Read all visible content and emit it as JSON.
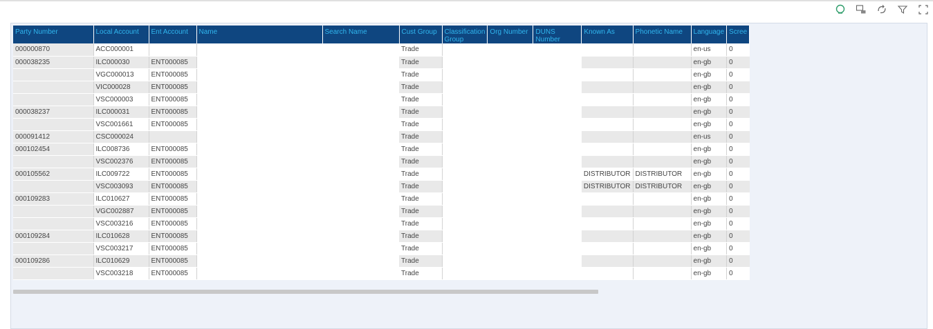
{
  "columns": [
    "Party Number",
    "Local Account",
    "Ent Account",
    "Name",
    "Search Name",
    "Cust Group",
    "Classification Group",
    "Org Number",
    "DUNS Number",
    "Known As",
    "Phonetic Name",
    "Language",
    "Scree"
  ],
  "rows": [
    {
      "party": "000000870",
      "local": "ACC000001",
      "ent": "",
      "cust": "Trade",
      "known": "",
      "phonetic": "",
      "lang": "en-us",
      "screen": "0"
    },
    {
      "party": "000038235",
      "local": "ILC000030",
      "ent": "ENT000085",
      "cust": "Trade",
      "known": "",
      "phonetic": "",
      "lang": "en-gb",
      "screen": "0"
    },
    {
      "party": "",
      "local": "VGC000013",
      "ent": "ENT000085",
      "cust": "Trade",
      "known": "",
      "phonetic": "",
      "lang": "en-gb",
      "screen": "0"
    },
    {
      "party": "",
      "local": "VIC000028",
      "ent": "ENT000085",
      "cust": "Trade",
      "known": "",
      "phonetic": "",
      "lang": "en-gb",
      "screen": "0"
    },
    {
      "party": "",
      "local": "VSC000003",
      "ent": "ENT000085",
      "cust": "Trade",
      "known": "",
      "phonetic": "",
      "lang": "en-gb",
      "screen": "0"
    },
    {
      "party": "000038237",
      "local": "ILC000031",
      "ent": "ENT000085",
      "cust": "Trade",
      "known": "",
      "phonetic": "",
      "lang": "en-gb",
      "screen": "0"
    },
    {
      "party": "",
      "local": "VSC001661",
      "ent": "ENT000085",
      "cust": "Trade",
      "known": "",
      "phonetic": "",
      "lang": "en-gb",
      "screen": "0"
    },
    {
      "party": "000091412",
      "local": "CSC000024",
      "ent": "",
      "cust": "Trade",
      "known": "",
      "phonetic": "",
      "lang": "en-us",
      "screen": "0"
    },
    {
      "party": "000102454",
      "local": "ILC008736",
      "ent": "ENT000085",
      "cust": "Trade",
      "known": "",
      "phonetic": "",
      "lang": "en-gb",
      "screen": "0"
    },
    {
      "party": "",
      "local": "VSC002376",
      "ent": "ENT000085",
      "cust": "Trade",
      "known": "",
      "phonetic": "",
      "lang": "en-gb",
      "screen": "0"
    },
    {
      "party": "000105562",
      "local": "ILC009722",
      "ent": "ENT000085",
      "cust": "Trade",
      "known": "DISTRIBUTOR",
      "phonetic": "DISTRIBUTOR",
      "lang": "en-gb",
      "screen": "0"
    },
    {
      "party": "",
      "local": "VSC003093",
      "ent": "ENT000085",
      "cust": "Trade",
      "known": "DISTRIBUTOR",
      "phonetic": "DISTRIBUTOR",
      "lang": "en-gb",
      "screen": "0"
    },
    {
      "party": "000109283",
      "local": "ILC010627",
      "ent": "ENT000085",
      "cust": "Trade",
      "known": "",
      "phonetic": "",
      "lang": "en-gb",
      "screen": "0"
    },
    {
      "party": "",
      "local": "VGC002887",
      "ent": "ENT000085",
      "cust": "Trade",
      "known": "",
      "phonetic": "",
      "lang": "en-gb",
      "screen": "0"
    },
    {
      "party": "",
      "local": "VSC003216",
      "ent": "ENT000085",
      "cust": "Trade",
      "known": "",
      "phonetic": "",
      "lang": "en-gb",
      "screen": "0"
    },
    {
      "party": "000109284",
      "local": "ILC010628",
      "ent": "ENT000085",
      "cust": "Trade",
      "known": "",
      "phonetic": "",
      "lang": "en-gb",
      "screen": "0"
    },
    {
      "party": "",
      "local": "VSC003217",
      "ent": "ENT000085",
      "cust": "Trade",
      "known": "",
      "phonetic": "",
      "lang": "en-gb",
      "screen": "0"
    },
    {
      "party": "000109286",
      "local": "ILC010629",
      "ent": "ENT000085",
      "cust": "Trade",
      "known": "",
      "phonetic": "",
      "lang": "en-gb",
      "screen": "0"
    },
    {
      "party": "",
      "local": "VSC003218",
      "ent": "ENT000085",
      "cust": "Trade",
      "known": "",
      "phonetic": "",
      "lang": "en-gb",
      "screen": "0"
    }
  ],
  "toolbar_icons": [
    "chat-icon",
    "comment-icon",
    "sync-icon",
    "filter-icon",
    "fullscreen-icon"
  ],
  "colors": {
    "header_bg": "#0f4680",
    "header_text": "#30b6ee",
    "accent_green": "#2e9c6a"
  }
}
